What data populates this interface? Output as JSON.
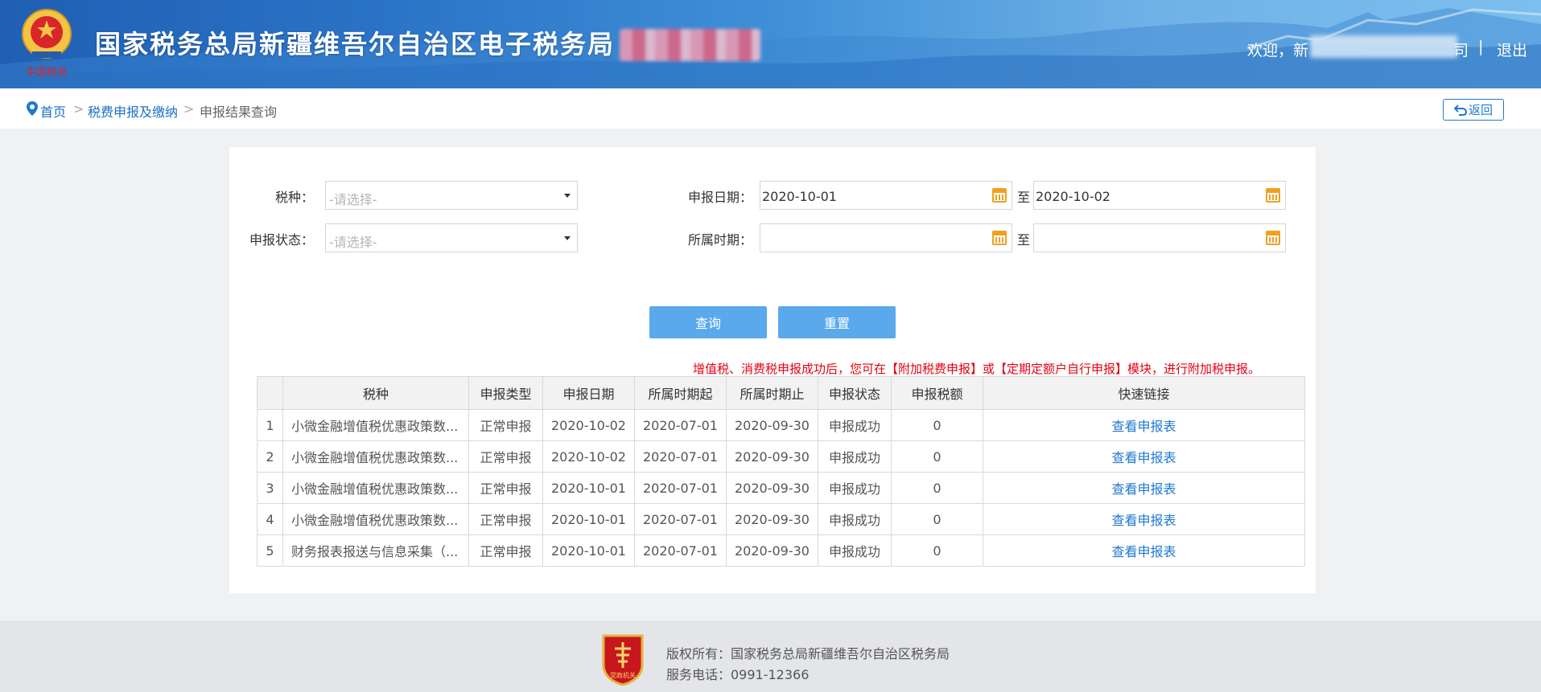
{
  "header": {
    "site_title": "国家税务总局新疆维吾尔自治区电子税务局",
    "welcome_prefix": "欢迎，新",
    "welcome_suffix": "司",
    "separator": "|",
    "logout_label": "退出",
    "emblem_text": "中国税务"
  },
  "breadcrumb": {
    "items": [
      "首页",
      "税费申报及缴纳",
      "申报结果查询"
    ],
    "separator": ">",
    "back_label": "返回"
  },
  "form": {
    "tax_type_label": "税种：",
    "tax_type_placeholder": "-请选择-",
    "status_label": "申报状态：",
    "status_placeholder": "-请选择-",
    "declare_date_label": "申报日期：",
    "declare_date_from": "2020-10-01",
    "declare_date_to": "2020-10-02",
    "period_label": "所属时期：",
    "period_from": "",
    "period_to": "",
    "to_label": "至",
    "query_label": "查询",
    "reset_label": "重置"
  },
  "notice": "增值税、消费税申报成功后，您可在【附加税费申报】或【定期定额户自行申报】模块，进行附加税申报。",
  "table": {
    "headers": [
      "",
      "税种",
      "申报类型",
      "申报日期",
      "所属时期起",
      "所属时期止",
      "申报状态",
      "申报税额",
      "快速链接"
    ],
    "rows": [
      [
        "1",
        "小微金融增值税优惠政策数...",
        "正常申报",
        "2020-10-02",
        "2020-07-01",
        "2020-09-30",
        "申报成功",
        "0",
        "查看申报表"
      ],
      [
        "2",
        "小微金融增值税优惠政策数...",
        "正常申报",
        "2020-10-02",
        "2020-07-01",
        "2020-09-30",
        "申报成功",
        "0",
        "查看申报表"
      ],
      [
        "3",
        "小微金融增值税优惠政策数...",
        "正常申报",
        "2020-10-01",
        "2020-07-01",
        "2020-09-30",
        "申报成功",
        "0",
        "查看申报表"
      ],
      [
        "4",
        "小微金融增值税优惠政策数...",
        "正常申报",
        "2020-10-01",
        "2020-07-01",
        "2020-09-30",
        "申报成功",
        "0",
        "查看申报表"
      ],
      [
        "5",
        "财务报表报送与信息采集（...",
        "正常申报",
        "2020-10-01",
        "2020-07-01",
        "2020-09-30",
        "申报成功",
        "0",
        "查看申报表"
      ]
    ]
  },
  "footer": {
    "copyright": "版权所有：国家税务总局新疆维吾尔自治区税务局",
    "phone": "服务电话：0991-12366",
    "logo_text": "党政机关"
  },
  "colors": {
    "primary_blue": "#1f78d1",
    "button_blue": "#5aa9ec",
    "notice_red": "#e60012",
    "calendar_orange": "#f0a020"
  }
}
